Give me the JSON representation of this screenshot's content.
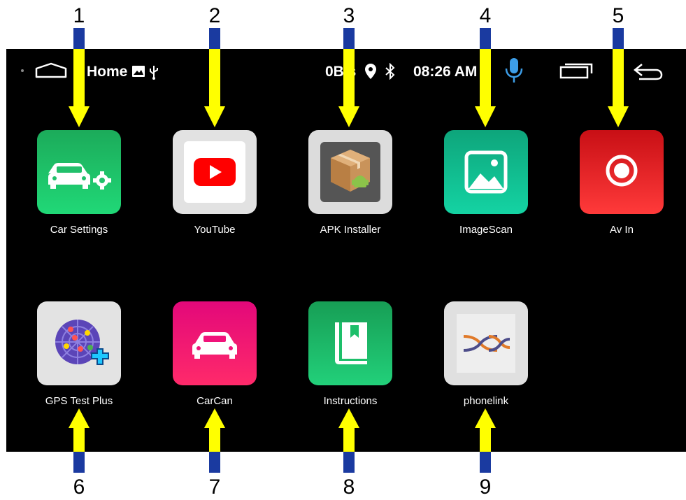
{
  "callouts": [
    "1",
    "2",
    "3",
    "4",
    "5",
    "6",
    "7",
    "8",
    "9"
  ],
  "status_bar": {
    "home_label": "Home",
    "network_speed": "0B/s",
    "time": "08:26 AM",
    "icons": [
      "dot-icon",
      "home-outline-icon",
      "image-icon",
      "usb-icon",
      "location-pin-icon",
      "bluetooth-icon",
      "microphone-icon",
      "recent-apps-icon",
      "back-icon"
    ]
  },
  "apps": [
    {
      "label": "Car Settings",
      "icon": "car-settings-icon",
      "color": "#1fc46a"
    },
    {
      "label": "YouTube",
      "icon": "youtube-icon",
      "color": "#e0e0e0"
    },
    {
      "label": "APK Installer",
      "icon": "apk-installer-icon",
      "color": "#dcdcdc"
    },
    {
      "label": "ImageScan",
      "icon": "image-scan-icon",
      "color": "#14c48f"
    },
    {
      "label": "Av In",
      "icon": "av-in-icon",
      "color": "#e51c23"
    },
    {
      "label": "GPS Test Plus",
      "icon": "gps-radar-icon",
      "color": "#e3e3e3"
    },
    {
      "label": "CarCan",
      "icon": "carcan-icon",
      "color": "#f0137a"
    },
    {
      "label": "Instructions",
      "icon": "instructions-book-icon",
      "color": "#1dbf6a"
    },
    {
      "label": "phonelink",
      "icon": "phonelink-icon",
      "color": "#e0e0e0"
    }
  ],
  "colors": {
    "arrow": "#ffff00",
    "arrow_shaft_top": "#1a3aa0",
    "mic": "#3d9ee8",
    "background": "#000000"
  }
}
